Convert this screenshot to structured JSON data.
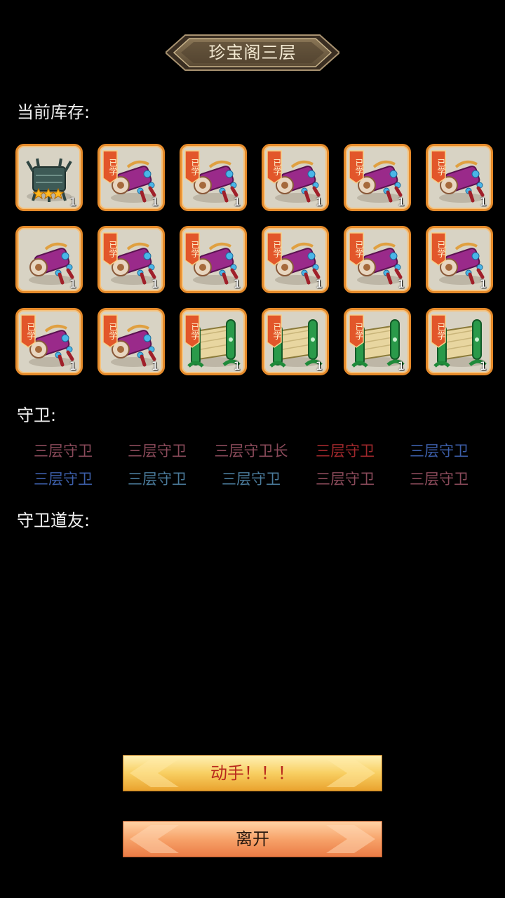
{
  "title": "珍宝阁三层",
  "inventory_label": "当前库存:",
  "guard_label": "守卫:",
  "guard_ally_label": "守卫道友:",
  "learned_tag_text": "已学",
  "inventory": [
    {
      "icon": "bronze-cauldron-icon",
      "stars": 3,
      "learned": false,
      "count": "1"
    },
    {
      "icon": "purple-scroll-icon",
      "learned": true,
      "count": "1"
    },
    {
      "icon": "purple-scroll-icon",
      "learned": true,
      "count": "1"
    },
    {
      "icon": "purple-scroll-icon",
      "learned": true,
      "count": "1"
    },
    {
      "icon": "purple-scroll-icon",
      "learned": true,
      "count": "1"
    },
    {
      "icon": "purple-scroll-icon",
      "learned": true,
      "count": "1"
    },
    {
      "icon": "purple-scroll-icon",
      "learned": false,
      "count": "1"
    },
    {
      "icon": "purple-scroll-icon",
      "learned": true,
      "count": "1"
    },
    {
      "icon": "purple-scroll-icon",
      "learned": true,
      "count": "1"
    },
    {
      "icon": "purple-scroll-icon",
      "learned": true,
      "count": "1"
    },
    {
      "icon": "purple-scroll-icon",
      "learned": true,
      "count": "1"
    },
    {
      "icon": "purple-scroll-icon",
      "learned": true,
      "count": "1"
    },
    {
      "icon": "purple-scroll-icon",
      "learned": true,
      "count": "1"
    },
    {
      "icon": "purple-scroll-icon",
      "learned": true,
      "count": "1"
    },
    {
      "icon": "green-scroll-icon",
      "learned": true,
      "count": "1"
    },
    {
      "icon": "green-scroll-icon",
      "learned": true,
      "count": "1"
    },
    {
      "icon": "green-scroll-icon",
      "learned": true,
      "count": "1"
    },
    {
      "icon": "green-scroll-icon",
      "learned": true,
      "count": "1"
    }
  ],
  "guards": [
    {
      "name": "三层守卫",
      "color": "#8a4a5a"
    },
    {
      "name": "三层守卫",
      "color": "#8a4a5a"
    },
    {
      "name": "三层守卫长",
      "color": "#8a4a5a"
    },
    {
      "name": "三层守卫",
      "color": "#a0282c"
    },
    {
      "name": "三层守卫",
      "color": "#3c5ea8"
    },
    {
      "name": "三层守卫",
      "color": "#3c5ea8"
    },
    {
      "name": "三层守卫",
      "color": "#4a7a9a"
    },
    {
      "name": "三层守卫",
      "color": "#4a7a9a"
    },
    {
      "name": "三层守卫",
      "color": "#8a4a5a"
    },
    {
      "name": "三层守卫",
      "color": "#8a4a5a"
    }
  ],
  "buttons": {
    "attack_label": "动手！！！",
    "leave_label": "离开"
  },
  "colors": {
    "attack_text": "#b8271c",
    "leave_text": "#2a1a10",
    "slot_border": "#e58a2a"
  }
}
